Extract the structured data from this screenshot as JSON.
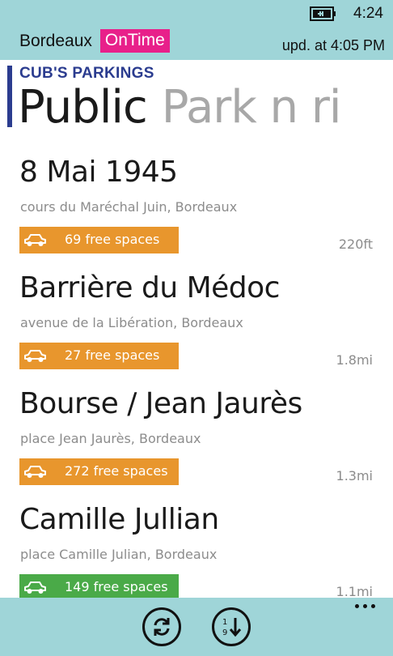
{
  "status": {
    "time": "4:24",
    "battery_icon": "battery-charging-icon"
  },
  "header": {
    "city": "Bordeaux",
    "brand": "OnTime",
    "brand_color": "#e8208a",
    "updated": "upd. at 4:05 PM",
    "background": "#9fd5d8"
  },
  "pivot": {
    "title": "CUB'S PARKINGS",
    "accent_color": "#2b3c8f",
    "tabs": [
      {
        "label": "Public"
      },
      {
        "label": "Park n ri"
      }
    ]
  },
  "parkings": [
    {
      "name": "8 Mai 1945",
      "address": "cours du Maréchal Juin, Bordeaux",
      "spaces": "69 free spaces",
      "distance": "220ft",
      "color": "#e8962d",
      "icon": "car-icon"
    },
    {
      "name": "Barrière du Médoc",
      "address": "avenue de la Libération, Bordeaux",
      "spaces": "27 free spaces",
      "distance": "1.8mi",
      "color": "#e8962d",
      "icon": "car-icon"
    },
    {
      "name": "Bourse / Jean Jaurès",
      "address": "place Jean Jaurès, Bordeaux",
      "spaces": "272 free spaces",
      "distance": "1.3mi",
      "color": "#e8962d",
      "icon": "car-icon"
    },
    {
      "name": "Camille Jullian",
      "address": "place Camille Julian, Bordeaux",
      "spaces": "149 free spaces",
      "distance": "1.1mi",
      "color": "#4aaa48",
      "icon": "car-icon"
    }
  ],
  "appbar": {
    "buttons": [
      {
        "icon": "refresh-icon"
      },
      {
        "icon": "sort-numeric-icon"
      }
    ],
    "more_icon": "more-dots-icon"
  }
}
